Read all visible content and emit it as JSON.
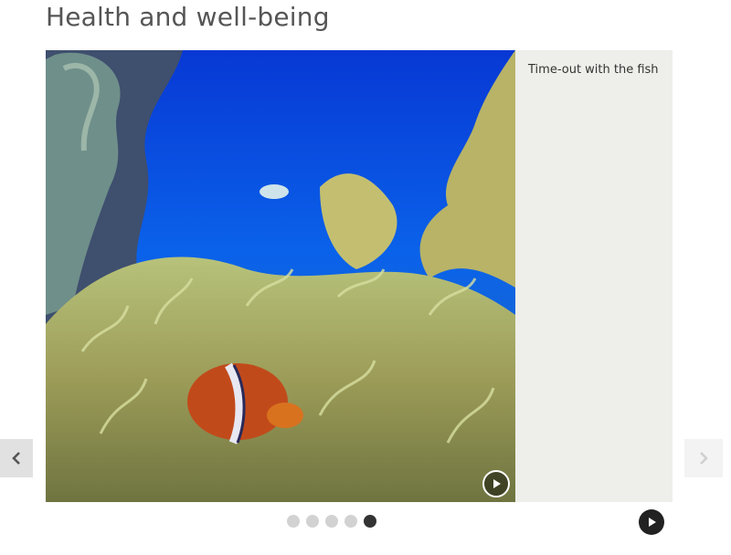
{
  "page": {
    "title": "Health and well-being"
  },
  "carousel": {
    "caption": "Time-out with the fish",
    "slide_count": 5,
    "active_index": 4
  },
  "icons": {
    "prev": "chevron-left-icon",
    "next": "chevron-right-icon",
    "video_play": "play-icon",
    "autoplay": "play-circle-icon"
  },
  "colors": {
    "caption_bg": "#eeeeea",
    "dot_inactive": "#d2d2d2",
    "dot_active": "#333333"
  }
}
